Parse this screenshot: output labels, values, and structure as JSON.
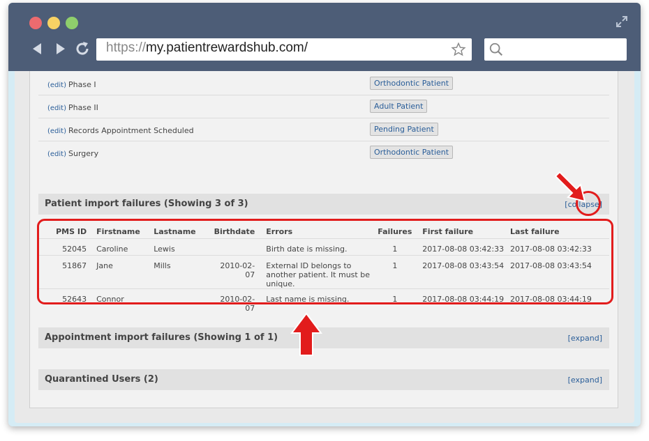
{
  "browser": {
    "url_protocol": "https://",
    "url_host": "my.patientrewardshub.com/",
    "search_placeholder": ""
  },
  "phases": [
    {
      "edit_label": "(edit)",
      "name": "Phase I",
      "status": "Orthodontic Patient"
    },
    {
      "edit_label": "(edit)",
      "name": "Phase II",
      "status": "Adult Patient"
    },
    {
      "edit_label": "(edit)",
      "name": "Records Appointment Scheduled",
      "status": "Pending Patient"
    },
    {
      "edit_label": "(edit)",
      "name": "Surgery",
      "status": "Orthodontic Patient"
    }
  ],
  "patient_failures": {
    "title": "Patient import failures (Showing 3 of 3)",
    "toggle_label": "[collapse]",
    "columns": [
      "PMS ID",
      "Firstname",
      "Lastname",
      "Birthdate",
      "Errors",
      "Failures",
      "First failure",
      "Last failure"
    ],
    "rows": [
      {
        "pms_id": "52045",
        "firstname": "Caroline",
        "lastname": "Lewis",
        "birthdate": "",
        "errors": "Birth date is missing.",
        "failures": "1",
        "first_failure": "2017-08-08 03:42:33",
        "last_failure": "2017-08-08 03:42:33"
      },
      {
        "pms_id": "51867",
        "firstname": "Jane",
        "lastname": "Mills",
        "birthdate": "2010-02-07",
        "errors": "External ID belongs to another patient. It must be unique.",
        "failures": "1",
        "first_failure": "2017-08-08 03:43:54",
        "last_failure": "2017-08-08 03:43:54"
      },
      {
        "pms_id": "52643",
        "firstname": "Connor",
        "lastname": "",
        "birthdate": "2010-02-07",
        "errors": "Last name is missing.",
        "failures": "1",
        "first_failure": "2017-08-08 03:44:19",
        "last_failure": "2017-08-08 03:44:19"
      }
    ]
  },
  "appointment_failures": {
    "title": "Appointment import failures (Showing 1 of 1)",
    "toggle_label": "[expand]"
  },
  "quarantined": {
    "title": "Quarantined Users (2)",
    "toggle_label": "[expand]"
  },
  "colors": {
    "titlebar": "#4d5d77",
    "link": "#2a5e99",
    "highlight": "#e21c1c"
  }
}
